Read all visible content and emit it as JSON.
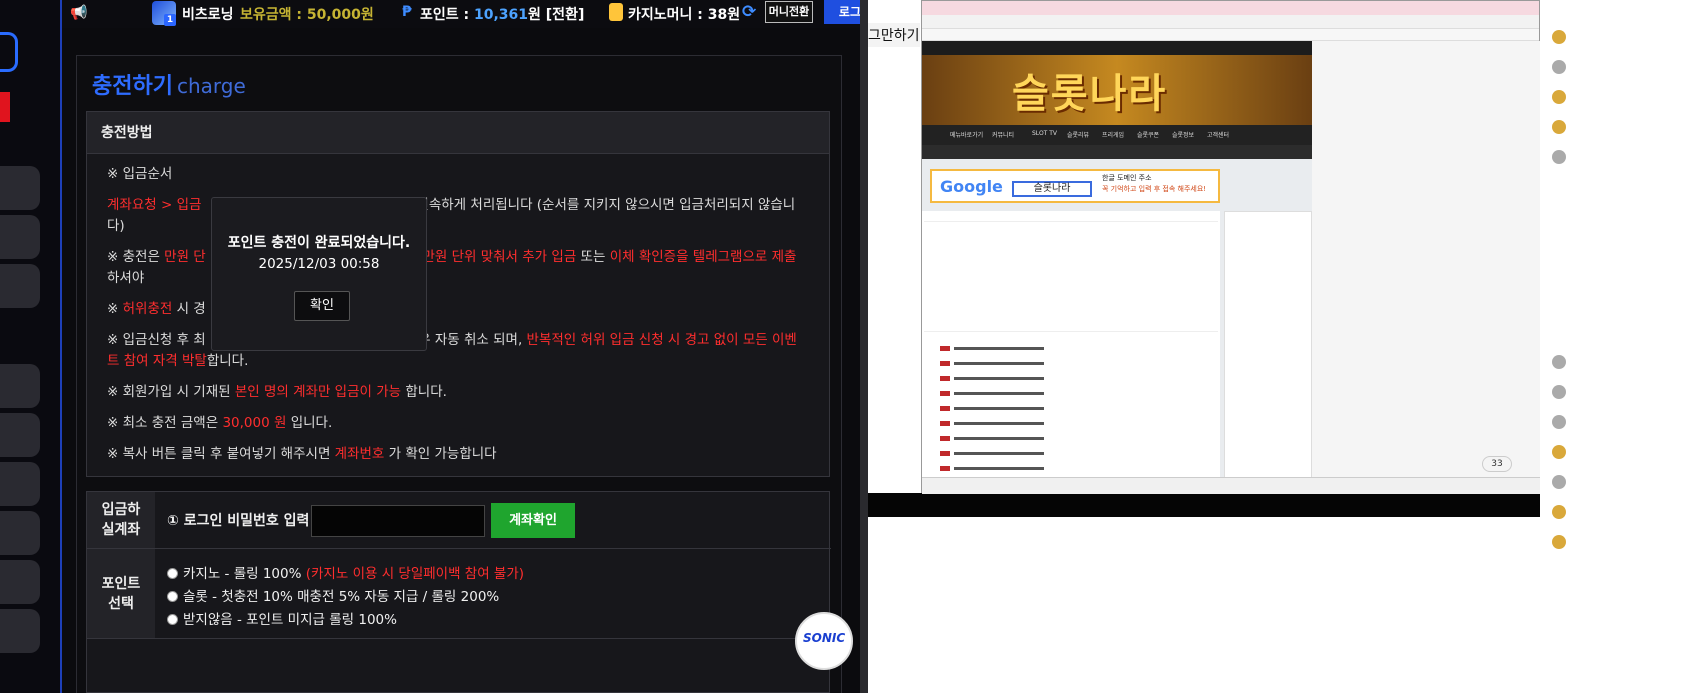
{
  "header": {
    "username": "비츠로닝",
    "level": "1",
    "holding_overlay": "보유금액 : 50,000원",
    "point_label": "포인트 : ",
    "point_value": "10,361",
    "point_suffix": "원 [전환]",
    "casino_money": "카지노머니 : 38원",
    "money_switch_button": "머니전환",
    "logout_button": "로그아웃"
  },
  "page": {
    "title": "충전하기",
    "title_en": "charge"
  },
  "method": {
    "heading": "충전방법",
    "rules": {
      "order": "※ 입금순서",
      "r1_red": "계좌요청 > 입금",
      "r1_text": "신속하게 처리됩니다 (순서를 지키지 않으시면 입금처리되지 않습니다)",
      "r2_a": "※ 충전은",
      "r2_red1": "만원 단",
      "r2_b": "시",
      "r2_red2": "만원 단위 맞춰서 추가 입금",
      "r2_c": "또는",
      "r2_red3": "이체 확인증을 텔레그램으로 제출",
      "r2_d": "하셔야",
      "r3_a": "※",
      "r3_red": "허위충전",
      "r3_b": "시 경",
      "r4_a": "※ 입금신청 후 최",
      "r4_b": "경우 자동 취소 되며,",
      "r4_red": "반복적인 허위 입금 신청 시 경고 없이 모든 이벤트 참여 자격 박탈",
      "r4_c": "합니다.",
      "r5_a": "※ 회원가입 시 기재된",
      "r5_red": "본인 명의 계좌만 입금이 가능",
      "r5_b": "합니다.",
      "r6_a": "※ 최소 충전 금액은",
      "r6_red": "30,000 원",
      "r6_b": "입니다.",
      "r7_a": "※ 복사 버튼 클릭 후 붙여넣기 해주시면",
      "r7_red": "계좌번호",
      "r7_b": "가 확인 가능합니다"
    }
  },
  "form": {
    "deposit_label": "입금하실계좌",
    "deposit_label_1": "입금하",
    "deposit_label_2": "실계좌",
    "password_label": "① 로그인 비밀번호 입력",
    "password_value": "",
    "account_check_button": "계좌확인",
    "point_label_1": "포인트",
    "point_label_2": "선택",
    "options": [
      {
        "text": "카지노 - 롤링 100%",
        "note": "(카지노 이용 시 당일페이백 참여 불가)"
      },
      {
        "text": "슬롯 - 첫충전 10% 매충전 5% 자동 지급 / 롤링 200%",
        "note": ""
      },
      {
        "text": "받지않음 - 포인트 미지급 롤링 100%",
        "note": ""
      }
    ]
  },
  "modal": {
    "message": "포인트 충전이 완료되었습니다.",
    "timestamp": "2025/12/03 00:58",
    "ok_button": "확인"
  },
  "sonic_logo": "SONIC",
  "right": {
    "cut_title": "그만하기",
    "banner_text": "슬롯나라",
    "google_text": "Google",
    "google_search": "슬롯나라",
    "google_caption": "한글 도메인 주소",
    "google_caption2": "꼭 기억하고 입력 후 접속 해주세요!",
    "badge": "33",
    "nav_items": [
      "메뉴바로가기",
      "커뮤니티",
      "SLOT TV",
      "슬롯리뷰",
      "프리게임",
      "슬롯쿠폰",
      "슬롯정보",
      "고객센터"
    ]
  },
  "colors": {
    "accent_blue": "#2e6cff",
    "red_text": "#ff2e2e",
    "green_button": "#1fa52e",
    "logout_blue": "#1f4fe0"
  }
}
